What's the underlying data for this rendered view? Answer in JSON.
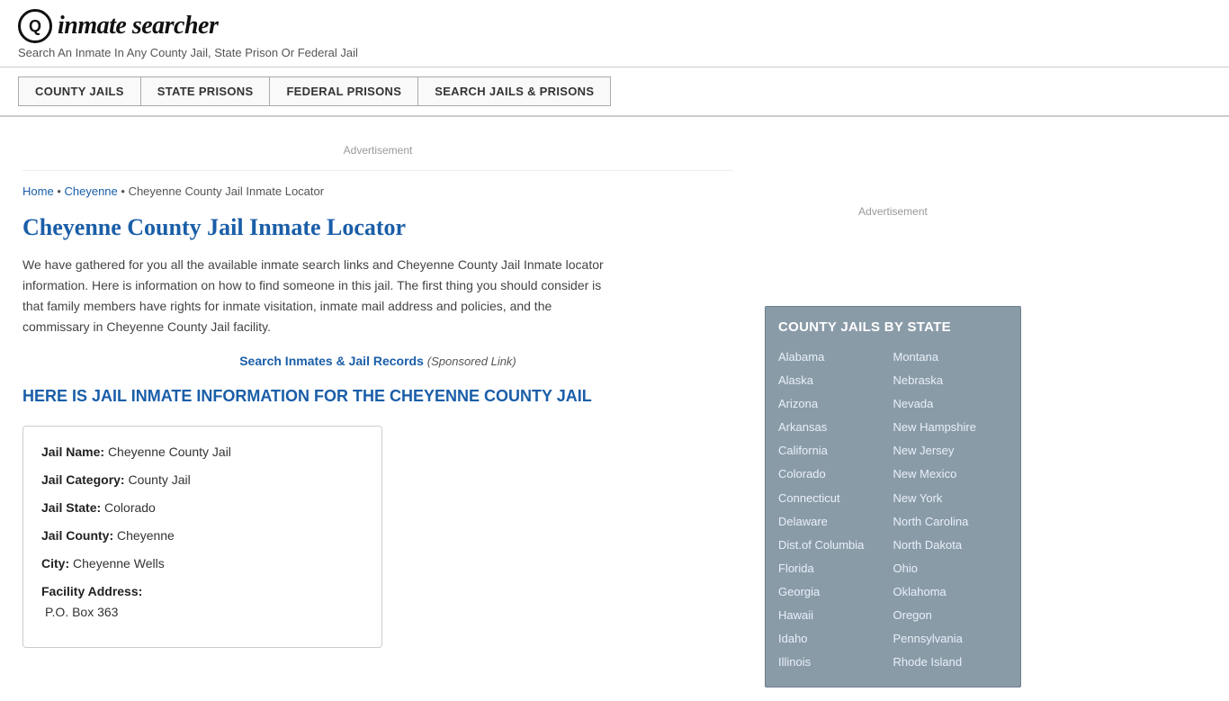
{
  "header": {
    "logo_icon": "Q",
    "logo_text": "inmate searcher",
    "tagline": "Search An Inmate In Any County Jail, State Prison Or Federal Jail"
  },
  "nav": {
    "items": [
      {
        "label": "COUNTY JAILS",
        "id": "county-jails"
      },
      {
        "label": "STATE PRISONS",
        "id": "state-prisons"
      },
      {
        "label": "FEDERAL PRISONS",
        "id": "federal-prisons"
      },
      {
        "label": "SEARCH JAILS & PRISONS",
        "id": "search-jails"
      }
    ]
  },
  "ad_banner": "Advertisement",
  "breadcrumb": {
    "home": "Home",
    "cheyenne": "Cheyenne",
    "current": "Cheyenne County Jail Inmate Locator"
  },
  "page_title": "Cheyenne County Jail Inmate Locator",
  "intro_text": "We have gathered for you all the available inmate search links and Cheyenne County Jail Inmate locator information. Here is information on how to find someone in this jail. The first thing you should consider is that family members have rights for inmate visitation, inmate mail address and policies, and the commissary in Cheyenne County Jail facility.",
  "sponsored": {
    "link_text": "Search Inmates & Jail Records",
    "suffix": "(Sponsored Link)"
  },
  "section_heading": "HERE IS JAIL INMATE INFORMATION FOR THE CHEYENNE COUNTY JAIL",
  "jail_info": {
    "name_label": "Jail Name:",
    "name_value": "Cheyenne County Jail",
    "category_label": "Jail Category:",
    "category_value": "County Jail",
    "state_label": "Jail State:",
    "state_value": "Colorado",
    "county_label": "Jail County:",
    "county_value": "Cheyenne",
    "city_label": "City:",
    "city_value": "Cheyenne Wells",
    "address_label": "Facility Address:",
    "address_value": "P.O. Box 363"
  },
  "sidebar": {
    "ad_text": "Advertisement",
    "state_box_title": "COUNTY JAILS BY STATE",
    "states_left": [
      "Alabama",
      "Alaska",
      "Arizona",
      "Arkansas",
      "California",
      "Colorado",
      "Connecticut",
      "Delaware",
      "Dist.of Columbia",
      "Florida",
      "Georgia",
      "Hawaii",
      "Idaho",
      "Illinois"
    ],
    "states_right": [
      "Montana",
      "Nebraska",
      "Nevada",
      "New Hampshire",
      "New Jersey",
      "New Mexico",
      "New York",
      "North Carolina",
      "North Dakota",
      "Ohio",
      "Oklahoma",
      "Oregon",
      "Pennsylvania",
      "Rhode Island"
    ]
  }
}
